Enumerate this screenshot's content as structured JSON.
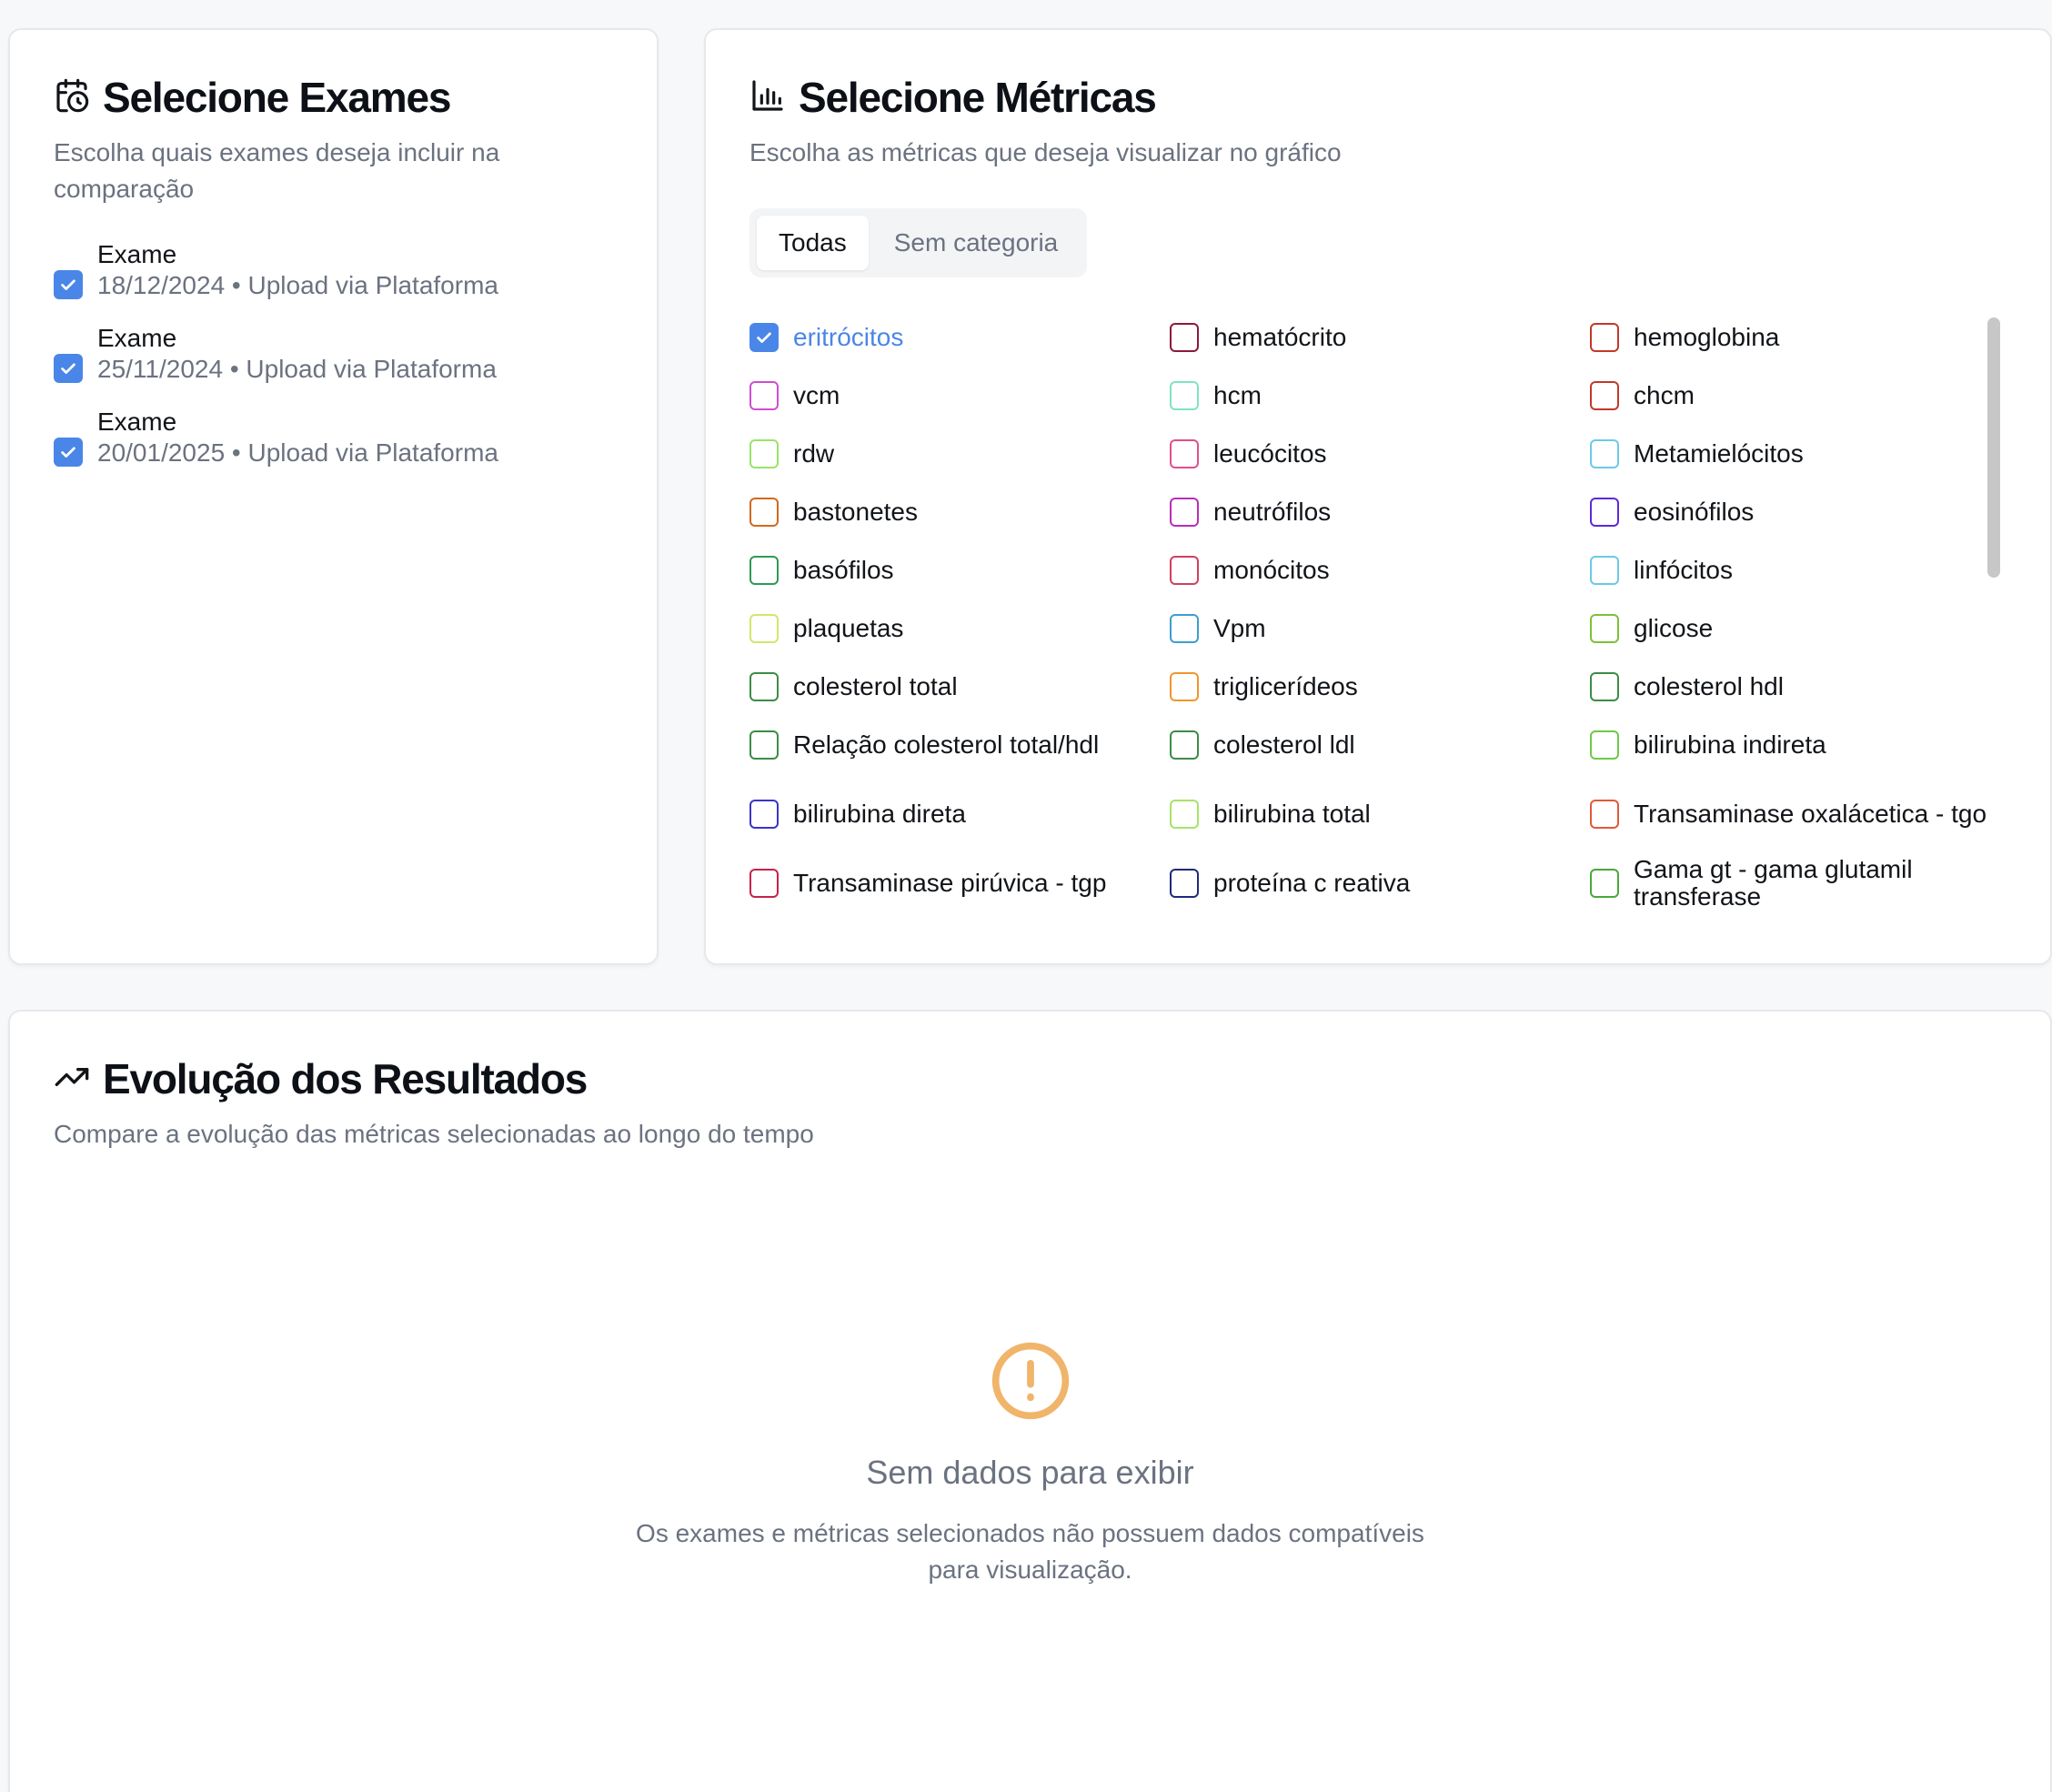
{
  "exams_card": {
    "title": "Selecione Exames",
    "subtitle": "Escolha quais exames deseja incluir na comparação",
    "items": [
      {
        "name": "Exame",
        "meta": "18/12/2024 • Upload via Plataforma",
        "checked": true
      },
      {
        "name": "Exame",
        "meta": "25/11/2024 • Upload via Plataforma",
        "checked": true
      },
      {
        "name": "Exame",
        "meta": "20/01/2025 • Upload via Plataforma",
        "checked": true
      }
    ]
  },
  "metrics_card": {
    "title": "Selecione Métricas",
    "subtitle": "Escolha as métricas que deseja visualizar no gráfico",
    "tabs": [
      {
        "label": "Todas",
        "active": true
      },
      {
        "label": "Sem categoria",
        "active": false
      }
    ],
    "metrics": [
      {
        "label": "eritrócitos",
        "color": "#4a86e8",
        "checked": true
      },
      {
        "label": "hematócrito",
        "color": "#8b1a3a",
        "checked": false
      },
      {
        "label": "hemoglobina",
        "color": "#c0392b",
        "checked": false
      },
      {
        "label": "vcm",
        "color": "#d04ed0",
        "checked": false
      },
      {
        "label": "hcm",
        "color": "#7fe3c1",
        "checked": false
      },
      {
        "label": "chcm",
        "color": "#c0392b",
        "checked": false
      },
      {
        "label": "rdw",
        "color": "#9be36a",
        "checked": false
      },
      {
        "label": "leucócitos",
        "color": "#e0508a",
        "checked": false
      },
      {
        "label": "Metamielócitos",
        "color": "#6cc9e8",
        "checked": false
      },
      {
        "label": "bastonetes",
        "color": "#d2691e",
        "checked": false
      },
      {
        "label": "neutrófilos",
        "color": "#b82fb8",
        "checked": false
      },
      {
        "label": "eosinófilos",
        "color": "#5b2bd6",
        "checked": false
      },
      {
        "label": "basófilos",
        "color": "#2e9b52",
        "checked": false
      },
      {
        "label": "monócitos",
        "color": "#d0405e",
        "checked": false
      },
      {
        "label": "linfócitos",
        "color": "#6cc9e8",
        "checked": false
      },
      {
        "label": "plaquetas",
        "color": "#cfe86a",
        "checked": false
      },
      {
        "label": "Vpm",
        "color": "#3c9ecf",
        "checked": false
      },
      {
        "label": "glicose",
        "color": "#7fbf3a",
        "checked": false
      },
      {
        "label": "colesterol total",
        "color": "#3c8c46",
        "checked": false
      },
      {
        "label": "triglicerídeos",
        "color": "#f0962c",
        "checked": false
      },
      {
        "label": "colesterol hdl",
        "color": "#3c8c46",
        "checked": false
      },
      {
        "label": "Relação colesterol total/hdl",
        "color": "#3c8c46",
        "checked": false
      },
      {
        "label": "colesterol ldl",
        "color": "#3c8c46",
        "checked": false
      },
      {
        "label": "bilirubina indireta",
        "color": "#6fc84a",
        "checked": false
      },
      {
        "label": "bilirubina direta",
        "color": "#3b34c8",
        "checked": false
      },
      {
        "label": "bilirubina total",
        "color": "#a6e36a",
        "checked": false
      },
      {
        "label": "Transaminase oxalácetica - tgo",
        "color": "#e0593a",
        "checked": false
      },
      {
        "label": "Transaminase pirúvica - tgp",
        "color": "#c8224a",
        "checked": false
      },
      {
        "label": "proteína c reativa",
        "color": "#1f2a7a",
        "checked": false
      },
      {
        "label": "Gama gt - gama glutamil transferase",
        "color": "#4aa83a",
        "checked": false
      }
    ]
  },
  "evolution_card": {
    "title": "Evolução dos Resultados",
    "subtitle": "Compare a evolução das métricas selecionadas ao longo do tempo",
    "empty_title": "Sem dados para exibir",
    "empty_desc": "Os exames e métricas selecionados não possuem dados compatíveis para visualização.",
    "warning_color": "#f0b46a"
  }
}
